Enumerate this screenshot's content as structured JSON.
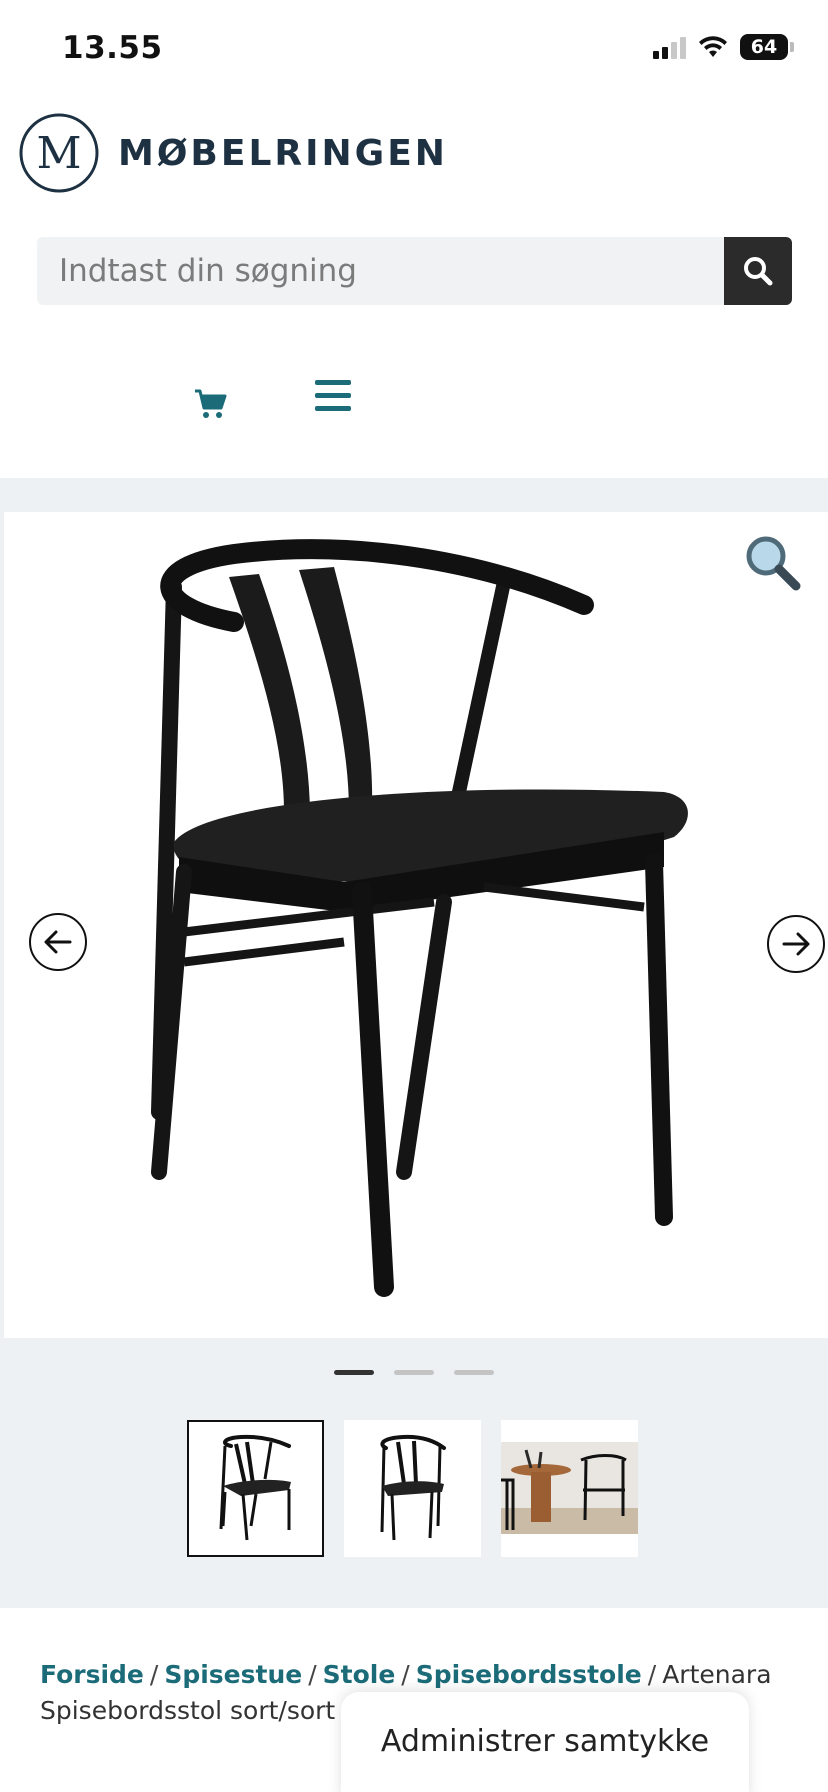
{
  "status_bar": {
    "time": "13.55",
    "battery": "64"
  },
  "header": {
    "logo_text": "MØBELRINGEN",
    "logo_letter": "M",
    "search_placeholder": "Indtast din søgning"
  },
  "gallery": {
    "active_slide": 1,
    "slide_count": 3,
    "thumbnails": [
      "thumb-1",
      "thumb-2",
      "thumb-3"
    ]
  },
  "breadcrumb": {
    "items": [
      "Forside",
      "Spisestue",
      "Stole",
      "Spisebordsstole"
    ],
    "current": "Artenara Spisebordsstol sort/sort",
    "separator": "/"
  },
  "consent": {
    "label": "Administrer samtykke"
  },
  "colors": {
    "accent": "#1b6b79",
    "brand_dark": "#1d3142",
    "gallery_bg": "#eef1f3"
  }
}
